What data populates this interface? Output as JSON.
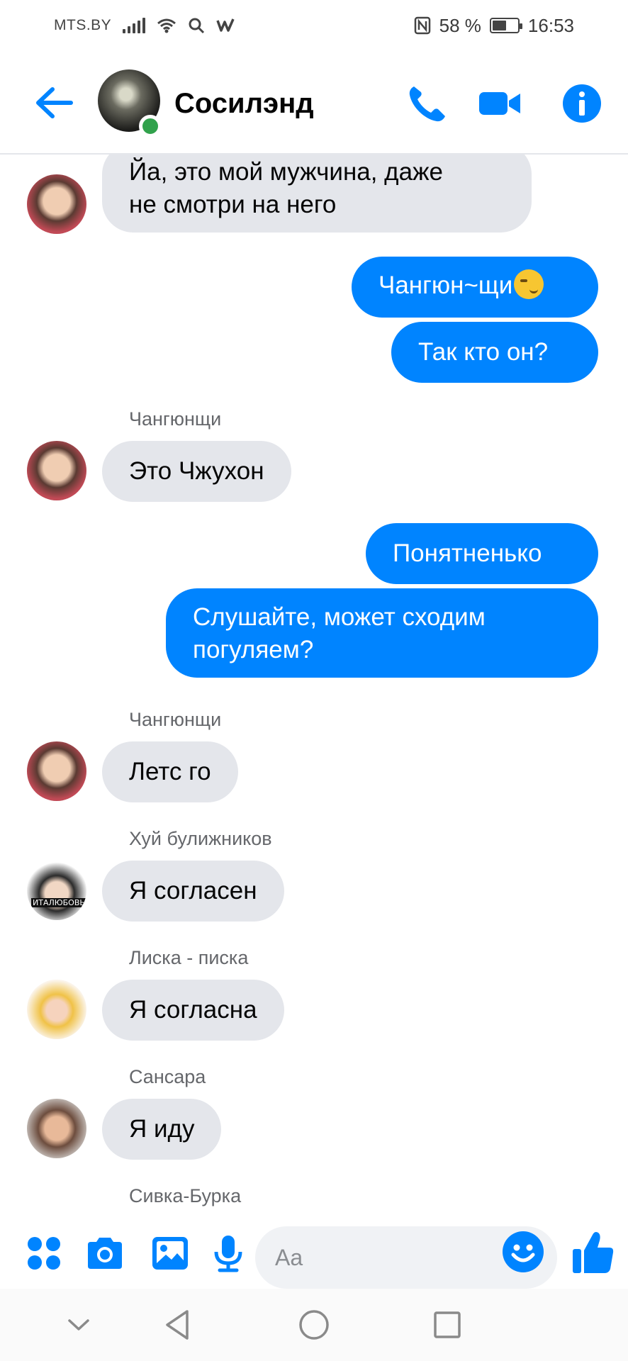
{
  "status_bar": {
    "carrier": "MTS.BY",
    "battery_text": "58 %",
    "battery_level": 0.58,
    "time": "16:53"
  },
  "header": {
    "title": "Сосилэнд",
    "online": true
  },
  "messages": [
    {
      "side": "in",
      "sender": "",
      "text": "Йа, это мой мужчина, даже",
      "text2": "не смотри на него",
      "avatar": "av-a"
    },
    {
      "side": "out",
      "text": "Чангюн~щи",
      "emoji": "smirking-face"
    },
    {
      "side": "out",
      "text": "Так кто он?"
    },
    {
      "side": "in",
      "sender": "Чангюнщи",
      "text": "Это Чжухон",
      "avatar": "av-a"
    },
    {
      "side": "out",
      "text": "Понятненько"
    },
    {
      "side": "out",
      "text": "Слушайте, может сходим",
      "text2": "погуляем?"
    },
    {
      "side": "in",
      "sender": "Чангюнщи",
      "text": "Летс го",
      "avatar": "av-a"
    },
    {
      "side": "in",
      "sender": "Хуй булижников",
      "text": "Я согласен",
      "avatar": "av-b",
      "avatar_caption": "ИТАЛЮБОВЬ"
    },
    {
      "side": "in",
      "sender": "Лиска - писка",
      "text": "Я согласна",
      "avatar": "av-c"
    },
    {
      "side": "in",
      "sender": "Сансара",
      "text": "Я иду",
      "avatar": "av-d"
    },
    {
      "side": "in",
      "sender": "Сивка-Бурка",
      "text": "",
      "avatar": ""
    }
  ],
  "composer": {
    "placeholder": "Aa",
    "icons": [
      "menu-dots-icon",
      "camera-icon",
      "gallery-icon",
      "microphone-icon",
      "emoji-icon",
      "thumbs-up-icon"
    ]
  },
  "colors": {
    "accent": "#0084ff",
    "incoming_bubble": "#e4e6eb",
    "online": "#31a24c"
  }
}
